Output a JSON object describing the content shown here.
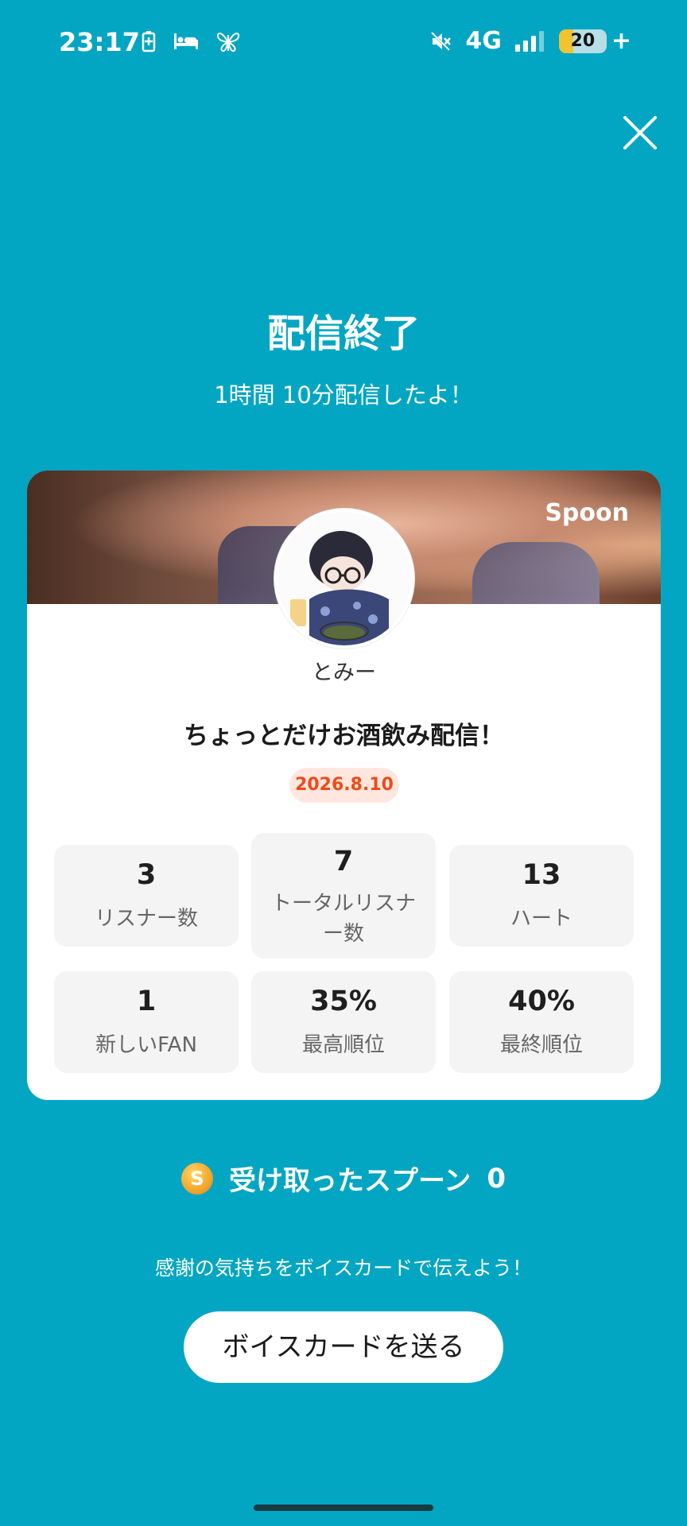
{
  "status_bar": {
    "time": "23:17",
    "network": "4G",
    "battery_level": "20",
    "battery_charging_symbol": "+",
    "icons": [
      "battery-saver-icon",
      "sleep-icon",
      "butterfly-icon",
      "mute-icon",
      "signal-icon",
      "battery-icon"
    ]
  },
  "header": {
    "title": "配信終了",
    "subtitle": "1時間 10分配信したよ！"
  },
  "card": {
    "brand": "Spoon",
    "username": "とみー",
    "stream_title": "ちょっとだけお酒飲み配信！",
    "date": "2026.8.10",
    "stats": [
      {
        "value": "3",
        "label": "リスナー数"
      },
      {
        "value": "7",
        "label": "トータルリスナー数"
      },
      {
        "value": "13",
        "label": "ハート"
      },
      {
        "value": "1",
        "label": "新しいFAN"
      },
      {
        "value": "35%",
        "label": "最高順位"
      },
      {
        "value": "40%",
        "label": "最終順位"
      }
    ]
  },
  "spoons": {
    "coin_symbol": "S",
    "label": "受け取ったスプーン",
    "count": "0"
  },
  "footer": {
    "message": "感謝の気持ちをボイスカードで伝えよう！",
    "button_label": "ボイスカードを送る"
  },
  "colors": {
    "background": "#02a6c2",
    "date_badge_text": "#f04a17",
    "date_badge_bg": "#ffe7df"
  }
}
